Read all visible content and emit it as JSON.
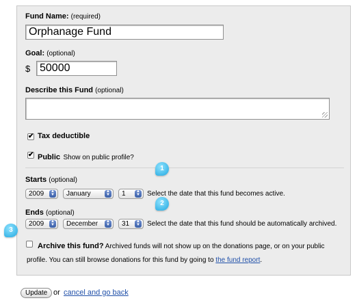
{
  "fund_name": {
    "label": "Fund Name:",
    "hint": "(required)",
    "value": "Orphanage Fund"
  },
  "goal": {
    "label": "Goal:",
    "hint": "(optional)",
    "currency": "$",
    "value": "50000"
  },
  "description": {
    "label": "Describe this Fund",
    "hint": "(optional)",
    "value": ""
  },
  "tax_deductible": {
    "label": "Tax deductible",
    "checked": true,
    "mark": "✔"
  },
  "public": {
    "label": "Public",
    "sub": "Show on public profile?",
    "checked": true,
    "mark": "✔"
  },
  "starts": {
    "label": "Starts",
    "hint": "(optional)",
    "year": "2009",
    "month": "January",
    "day": "1",
    "help": "Select the date that this fund becomes active."
  },
  "ends": {
    "label": "Ends",
    "hint": "(optional)",
    "year": "2009",
    "month": "December",
    "day": "31",
    "help": "Select the date that this fund should be automatically archived."
  },
  "archive": {
    "label": "Archive this fund?",
    "text_1": "Archived funds will not show up on the donations page, or on your public",
    "text_2": "profile. You can still browse donations for this fund by going to",
    "link": "the fund report",
    "text_end": "."
  },
  "callouts": [
    "1",
    "2",
    "3"
  ],
  "actions": {
    "update": "Update",
    "or": "or",
    "cancel": "cancel and go back"
  },
  "colors": {
    "panel_bg": "#ececec",
    "callout": "#21a7df",
    "link": "#1f4fa8"
  }
}
